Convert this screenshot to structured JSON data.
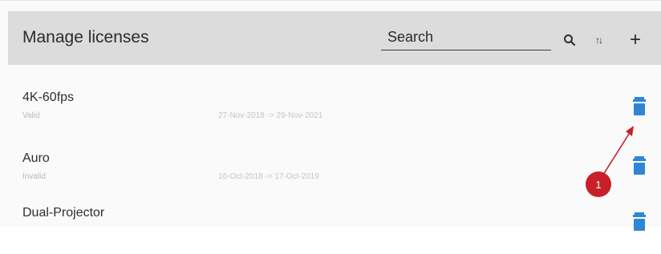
{
  "header": {
    "title": "Manage licenses",
    "search": {
      "placeholder": "Search",
      "value": ""
    },
    "icons": [
      "search-icon",
      "sort-icon",
      "add-icon"
    ],
    "sort_glyph": "↑↓",
    "add_glyph": "+"
  },
  "licenses": [
    {
      "name": "4K-60fps",
      "status": "Valid",
      "dates": "27-Nov-2018 -> 29-Nov-2021"
    },
    {
      "name": "Auro",
      "status": "Invalid",
      "dates": "16-Oct-2018 -> 17-Oct-2019"
    },
    {
      "name": "Dual-Projector",
      "status": "",
      "dates": ""
    }
  ],
  "callout": {
    "number": "1"
  },
  "colors": {
    "accent": "#2f86d6",
    "header_bg": "#dcdcdc",
    "callout": "#c8202a"
  }
}
